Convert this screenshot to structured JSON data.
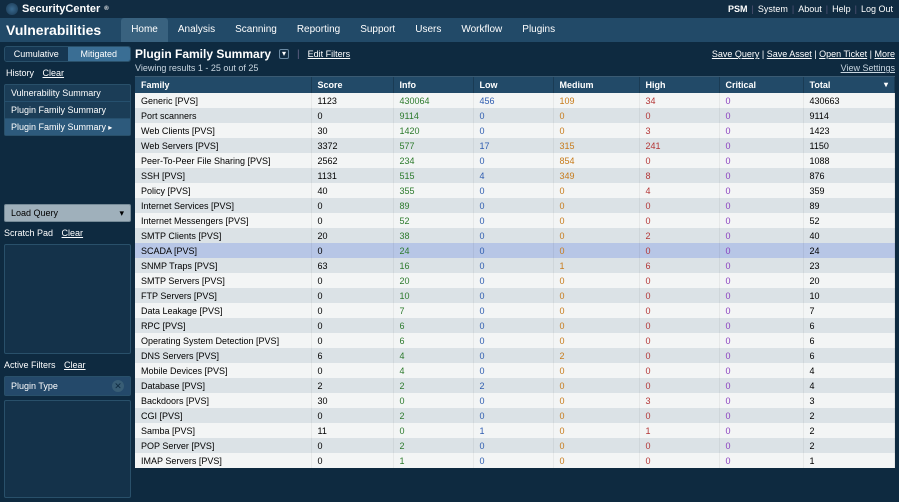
{
  "brand": "SecurityCenter",
  "toplinks": [
    "PSM",
    "System",
    "About",
    "Help",
    "Log Out"
  ],
  "app_title": "Vulnerabilities",
  "menu": [
    "Home",
    "Analysis",
    "Scanning",
    "Reporting",
    "Support",
    "Users",
    "Workflow",
    "Plugins"
  ],
  "menu_active": "Home",
  "toggle": {
    "left": "Cumulative",
    "right": "Mitigated"
  },
  "history_label": "History",
  "clear_label": "Clear",
  "nav": [
    "Vulnerability Summary",
    "Plugin Family Summary",
    "Plugin Family Summary"
  ],
  "nav_active_index": 2,
  "load_query": "Load Query",
  "scratch_label": "Scratch Pad",
  "active_filters_label": "Active Filters",
  "filters": [
    "Plugin Type"
  ],
  "page_title": "Plugin Family Summary",
  "edit_filters": "Edit Filters",
  "viewing": "Viewing results 1 - 25 out of 25",
  "header_links": [
    "Save Query",
    "Save Asset",
    "Open Ticket",
    "More"
  ],
  "view_settings": "View Settings",
  "columns": [
    "Family",
    "Score",
    "Info",
    "Low",
    "Medium",
    "High",
    "Critical",
    "Total"
  ],
  "selected_row_index": 9,
  "rows": [
    {
      "family": "Generic [PVS]",
      "score": 1123,
      "info": 430064,
      "low": 456,
      "med": 109,
      "high": 34,
      "crit": 0,
      "total": 430663
    },
    {
      "family": "Port scanners",
      "score": 0,
      "info": 9114,
      "low": 0,
      "med": 0,
      "high": 0,
      "crit": 0,
      "total": 9114
    },
    {
      "family": "Web Clients [PVS]",
      "score": 30,
      "info": 1420,
      "low": 0,
      "med": 0,
      "high": 3,
      "crit": 0,
      "total": 1423
    },
    {
      "family": "Web Servers [PVS]",
      "score": 3372,
      "info": 577,
      "low": 17,
      "med": 315,
      "high": 241,
      "crit": 0,
      "total": 1150
    },
    {
      "family": "Peer-To-Peer File Sharing [PVS]",
      "score": 2562,
      "info": 234,
      "low": 0,
      "med": 854,
      "high": 0,
      "crit": 0,
      "total": 1088
    },
    {
      "family": "SSH [PVS]",
      "score": 1131,
      "info": 515,
      "low": 4,
      "med": 349,
      "high": 8,
      "crit": 0,
      "total": 876
    },
    {
      "family": "Policy [PVS]",
      "score": 40,
      "info": 355,
      "low": 0,
      "med": 0,
      "high": 4,
      "crit": 0,
      "total": 359
    },
    {
      "family": "Internet Services [PVS]",
      "score": 0,
      "info": 89,
      "low": 0,
      "med": 0,
      "high": 0,
      "crit": 0,
      "total": 89
    },
    {
      "family": "Internet Messengers [PVS]",
      "score": 0,
      "info": 52,
      "low": 0,
      "med": 0,
      "high": 0,
      "crit": 0,
      "total": 52
    },
    {
      "family": "SMTP Clients [PVS]",
      "score": 20,
      "info": 38,
      "low": 0,
      "med": 0,
      "high": 2,
      "crit": 0,
      "total": 40
    },
    {
      "family": "SCADA [PVS]",
      "score": 0,
      "info": 24,
      "low": 0,
      "med": 0,
      "high": 0,
      "crit": 0,
      "total": 24
    },
    {
      "family": "SNMP Traps [PVS]",
      "score": 63,
      "info": 16,
      "low": 0,
      "med": 1,
      "high": 6,
      "crit": 0,
      "total": 23
    },
    {
      "family": "SMTP Servers [PVS]",
      "score": 0,
      "info": 20,
      "low": 0,
      "med": 0,
      "high": 0,
      "crit": 0,
      "total": 20
    },
    {
      "family": "FTP Servers [PVS]",
      "score": 0,
      "info": 10,
      "low": 0,
      "med": 0,
      "high": 0,
      "crit": 0,
      "total": 10
    },
    {
      "family": "Data Leakage [PVS]",
      "score": 0,
      "info": 7,
      "low": 0,
      "med": 0,
      "high": 0,
      "crit": 0,
      "total": 7
    },
    {
      "family": "RPC [PVS]",
      "score": 0,
      "info": 6,
      "low": 0,
      "med": 0,
      "high": 0,
      "crit": 0,
      "total": 6
    },
    {
      "family": "Operating System Detection [PVS]",
      "score": 0,
      "info": 6,
      "low": 0,
      "med": 0,
      "high": 0,
      "crit": 0,
      "total": 6
    },
    {
      "family": "DNS Servers [PVS]",
      "score": 6,
      "info": 4,
      "low": 0,
      "med": 2,
      "high": 0,
      "crit": 0,
      "total": 6
    },
    {
      "family": "Mobile Devices [PVS]",
      "score": 0,
      "info": 4,
      "low": 0,
      "med": 0,
      "high": 0,
      "crit": 0,
      "total": 4
    },
    {
      "family": "Database [PVS]",
      "score": 2,
      "info": 2,
      "low": 2,
      "med": 0,
      "high": 0,
      "crit": 0,
      "total": 4
    },
    {
      "family": "Backdoors [PVS]",
      "score": 30,
      "info": 0,
      "low": 0,
      "med": 0,
      "high": 3,
      "crit": 0,
      "total": 3
    },
    {
      "family": "CGI [PVS]",
      "score": 0,
      "info": 2,
      "low": 0,
      "med": 0,
      "high": 0,
      "crit": 0,
      "total": 2
    },
    {
      "family": "Samba [PVS]",
      "score": 11,
      "info": 0,
      "low": 1,
      "med": 0,
      "high": 1,
      "crit": 0,
      "total": 2
    },
    {
      "family": "POP Server [PVS]",
      "score": 0,
      "info": 2,
      "low": 0,
      "med": 0,
      "high": 0,
      "crit": 0,
      "total": 2
    },
    {
      "family": "IMAP Servers [PVS]",
      "score": 0,
      "info": 1,
      "low": 0,
      "med": 0,
      "high": 0,
      "crit": 0,
      "total": 1
    }
  ]
}
